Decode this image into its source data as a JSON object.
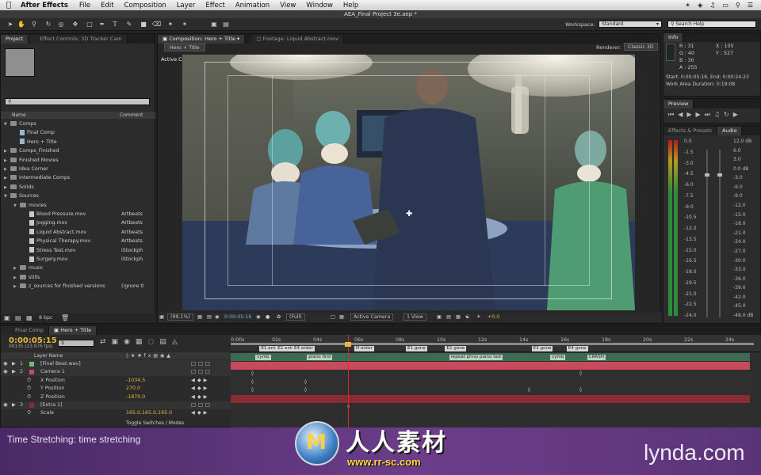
{
  "menubar": {
    "app": "After Effects",
    "items": [
      "File",
      "Edit",
      "Composition",
      "Layer",
      "Effect",
      "Animation",
      "View",
      "Window",
      "Help"
    ]
  },
  "window_title": "AEA_Final Project 3e.aep *",
  "toolbar": {
    "workspace_label": "Workspace:",
    "workspace_value": "Standard",
    "search_placeholder": "Search Help"
  },
  "project_panel": {
    "tab_project": "Project",
    "tab_effect_controls": "Effect Controls: 3D Tracker Cam",
    "col_name": "Name",
    "col_comment": "Comment",
    "bpc": "8 bpc",
    "items": [
      {
        "indent": 0,
        "type": "folder",
        "name": "Comps",
        "open": true,
        "comment": ""
      },
      {
        "indent": 1,
        "type": "comp",
        "name": "Final Comp",
        "comment": ""
      },
      {
        "indent": 1,
        "type": "comp",
        "name": "Hero + Title",
        "comment": ""
      },
      {
        "indent": 0,
        "type": "folder",
        "name": "Comps_Finished",
        "comment": ""
      },
      {
        "indent": 0,
        "type": "folder",
        "name": "Finished Movies",
        "comment": ""
      },
      {
        "indent": 0,
        "type": "folder",
        "name": "Idea Corner",
        "comment": ""
      },
      {
        "indent": 0,
        "type": "folder",
        "name": "Intermediate Comps",
        "comment": ""
      },
      {
        "indent": 0,
        "type": "folder",
        "name": "Solids",
        "comment": ""
      },
      {
        "indent": 0,
        "type": "folder",
        "name": "Sources",
        "open": true,
        "comment": ""
      },
      {
        "indent": 1,
        "type": "folder",
        "name": "movies",
        "open": true,
        "comment": ""
      },
      {
        "indent": 2,
        "type": "file",
        "name": "Blood Pressure.mov",
        "comment": "Artbeats"
      },
      {
        "indent": 2,
        "type": "file",
        "name": "Jogging.mov",
        "comment": "Artbeats"
      },
      {
        "indent": 2,
        "type": "file",
        "name": "Liquid Abstract.mov",
        "comment": "Artbeats"
      },
      {
        "indent": 2,
        "type": "file",
        "name": "Physical Therapy.mov",
        "comment": "Artbeats"
      },
      {
        "indent": 2,
        "type": "file",
        "name": "Stress Test.mov",
        "comment": "iStockph"
      },
      {
        "indent": 2,
        "type": "file",
        "name": "Surgery.mov",
        "comment": "iStockph"
      },
      {
        "indent": 1,
        "type": "folder",
        "name": "music",
        "comment": ""
      },
      {
        "indent": 1,
        "type": "folder",
        "name": "stills",
        "comment": ""
      },
      {
        "indent": 1,
        "type": "folder",
        "name": "z_sources for finished versions",
        "comment": "(ignore tl"
      }
    ]
  },
  "comp_panel": {
    "tab_comp": "Composition: Hero + Title",
    "tab_footage": "Footage: Liquid Abstract.mov",
    "comp_chip": "Hero + Title",
    "renderer_label": "Renderer:",
    "renderer_value": "Classic 3D",
    "active_camera_label": "Active Camera",
    "zoom": "(99.1%)",
    "timecode": "0:00:05:16",
    "resolution": "(Full)",
    "view_camera": "Active Camera",
    "views": "1 View",
    "exposure": "+0.0"
  },
  "info_panel": {
    "title": "Info",
    "r": "R : 31",
    "g": "G : 40",
    "b": "B : 30",
    "a": "A : 255",
    "x": "X : 105",
    "y": "Y : 527",
    "line1": "Start: 0:00:05:16, End: 0:00:24:23",
    "line2": "Work Area Duration: 0:19:08"
  },
  "preview_panel": {
    "title": "Preview"
  },
  "audio_panel": {
    "tab_effects": "Effects & Presets",
    "tab_audio": "Audio",
    "left_scale": [
      "0.0",
      "-1.5",
      "-3.0",
      "-4.5",
      "-6.0",
      "-7.5",
      "-9.0",
      "-10.5",
      "-12.0",
      "-13.5",
      "-15.0",
      "-16.5",
      "-18.0",
      "-19.5",
      "-21.0",
      "-22.5",
      "-24.0"
    ],
    "right_scale": [
      "12.0 dB",
      "6.0",
      "3.0",
      "0.0 dB",
      "-3.0",
      "-6.0",
      "-9.0",
      "-12.0",
      "-15.0",
      "-18.0",
      "-21.0",
      "-24.0",
      "-27.0",
      "-30.0",
      "-33.0",
      "-36.0",
      "-39.0",
      "-42.0",
      "-45.0",
      "-48.0 dB"
    ]
  },
  "timeline": {
    "tab_final": "Final Comp",
    "tab_hero": "Hero + Title",
    "timecode": "0:00:05:15",
    "frames": "00135 (23.976 fps)",
    "search_placeholder": "",
    "col_layer_name": "Layer Name",
    "toggle_label": "Toggle Switches / Modes",
    "layers": [
      {
        "kind": "layer",
        "num": "1",
        "name": "[Final Beat.wav]",
        "value": ""
      },
      {
        "kind": "layer",
        "num": "2",
        "name": "Camera 1",
        "value": ""
      },
      {
        "kind": "prop",
        "num": "",
        "name": "X Position",
        "value": "-1034.5"
      },
      {
        "kind": "prop",
        "num": "",
        "name": "Y Position",
        "value": "270.0"
      },
      {
        "kind": "prop",
        "num": "",
        "name": "Z Position",
        "value": "-1870.0"
      },
      {
        "kind": "layer",
        "num": "3",
        "name": "[Extra 1]",
        "value": ""
      },
      {
        "kind": "prop",
        "num": "",
        "name": "Scale",
        "value": "165.0,165.0,165.0"
      }
    ],
    "ruler": [
      "0:00s",
      "02s",
      "04s",
      "06s",
      "08s",
      "10s",
      "12s",
      "14s",
      "16s",
      "18s",
      "20s",
      "22s",
      "24s"
    ],
    "comp_markers": [
      "E1 enter",
      "E2 enter",
      "E4 enter",
      "H enter",
      "E1 gone",
      "E2 gone",
      "E3 gone",
      "E4 gone"
    ],
    "layer_markers": [
      "cymb",
      "piano first",
      "repeat phrase",
      "piano last",
      "cymb",
      "CRASH"
    ]
  },
  "overlay": {
    "lesson": "Time Stretching: time stretching",
    "watermark_cn": "人人素材",
    "watermark_url": "www.rr-sc.com",
    "brand": "lynda.com"
  },
  "colors": {
    "timecode": "#e8b840",
    "camera_layer": "#c64c5d",
    "extra_layer": "#8a2b33",
    "audio_bar": "#2f8a3a",
    "overlay_bg": "#5b3478"
  }
}
